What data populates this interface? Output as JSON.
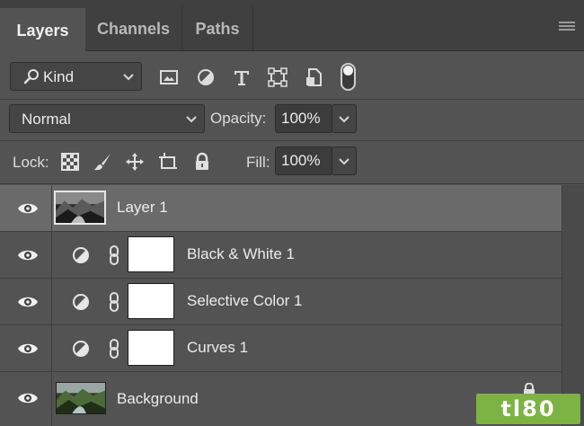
{
  "tabs": [
    {
      "label": "Layers",
      "active": true
    },
    {
      "label": "Channels",
      "active": false
    },
    {
      "label": "Paths",
      "active": false
    }
  ],
  "filter": {
    "kind_label": "Kind",
    "filter_icons": [
      "image-filter-icon",
      "adjustment-filter-icon",
      "type-filter-icon",
      "shape-filter-icon",
      "smart-object-filter-icon"
    ],
    "toggle_on": true
  },
  "blend": {
    "mode": "Normal",
    "opacity_label": "Opacity:",
    "opacity_value": "100%"
  },
  "lock": {
    "label": "Lock:",
    "fill_label": "Fill:",
    "fill_value": "100%"
  },
  "layers": [
    {
      "name": "Layer 1",
      "type": "photo",
      "selected": true,
      "visible": true
    },
    {
      "name": "Black & White 1",
      "type": "adjustment",
      "selected": false,
      "visible": true
    },
    {
      "name": "Selective Color 1",
      "type": "adjustment",
      "selected": false,
      "visible": true
    },
    {
      "name": "Curves 1",
      "type": "adjustment",
      "selected": false,
      "visible": true
    },
    {
      "name": "Background",
      "type": "photo",
      "selected": false,
      "visible": true,
      "locked": true
    }
  ],
  "watermark": "tl80",
  "colors": {
    "panel_bg": "#535353",
    "selected_row": "#6a6a6a",
    "watermark_green": "#7cb342"
  }
}
